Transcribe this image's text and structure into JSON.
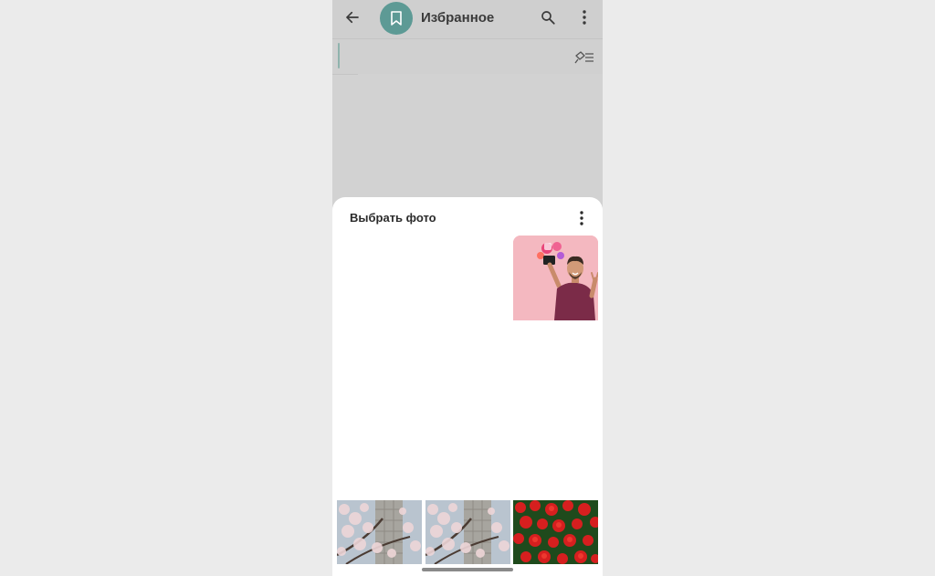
{
  "header": {
    "title": "Избранное",
    "back_icon": "arrow-left-icon",
    "avatar_icon": "bookmark-icon",
    "search_icon": "search-icon",
    "menu_icon": "more-vertical-icon",
    "avatar_color": "#5d9a95"
  },
  "pinned": {
    "icon": "pin-list-icon"
  },
  "sheet": {
    "title": "Выбрать фото",
    "menu_icon": "more-vertical-icon",
    "photos": [
      {
        "name": "man-selfie-photo"
      },
      {
        "name": "cherry-blossom-photo"
      },
      {
        "name": "cherry-blossom-photo"
      },
      {
        "name": "red-roses-photo"
      }
    ]
  },
  "colors": {
    "background": "#ebebeb",
    "dim_overlay": "#d2d2d2",
    "sheet": "#ffffff"
  }
}
